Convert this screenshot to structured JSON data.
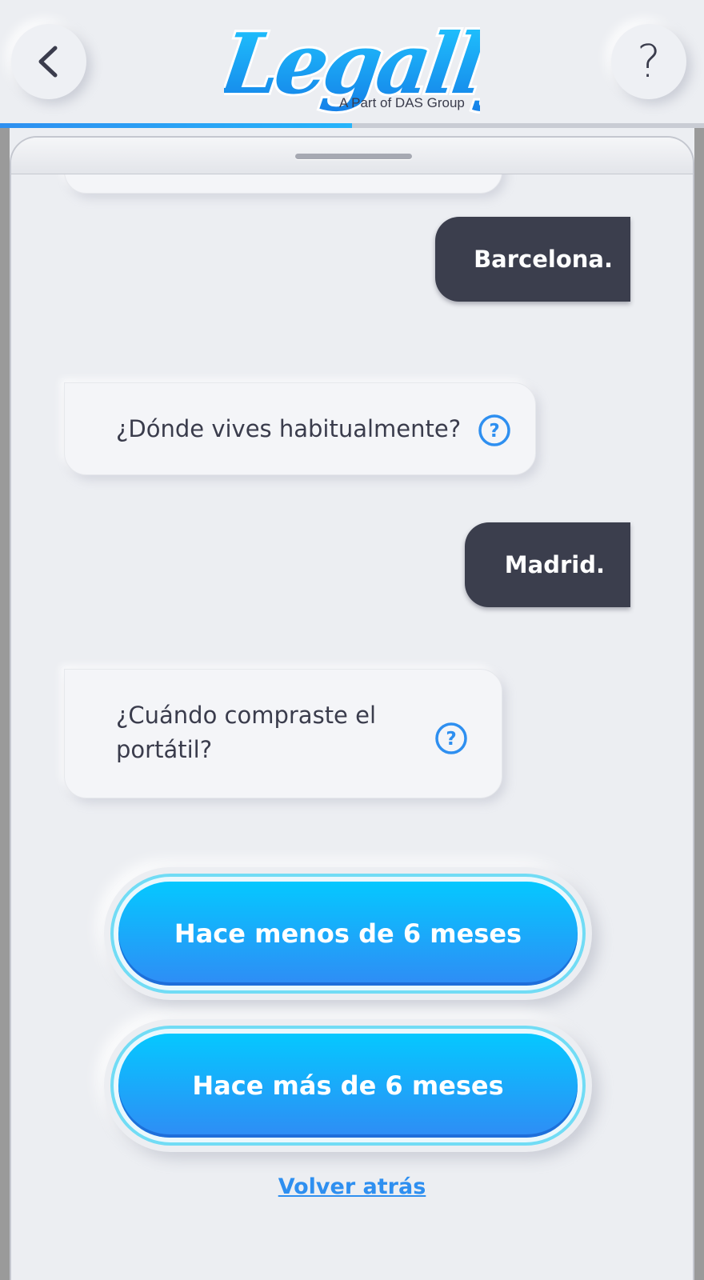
{
  "header": {
    "back_icon": "chevron-left-icon",
    "help_label": "?",
    "logo_text": "Legally",
    "logo_sub": "A Part of DAS Group",
    "progress": 0.5
  },
  "chat": {
    "messages": [
      {
        "from": "user",
        "text": "Barcelona."
      },
      {
        "from": "bot",
        "text": "¿Dónde vives habitualmente?",
        "help_icon": "question-circle-icon"
      },
      {
        "from": "user",
        "text": "Madrid."
      },
      {
        "from": "bot",
        "text": "¿Cuándo compraste el portátil?",
        "help_icon": "question-circle-icon"
      }
    ]
  },
  "answers": [
    {
      "label": "Hace menos de 6 meses"
    },
    {
      "label": "Hace más de 6 meses"
    }
  ],
  "back_link": "Volver atrás",
  "colors": {
    "accent": "#2e8ff0",
    "button_top": "#05c8ff",
    "button_bottom": "#2f8cf5",
    "user_bubble": "#3b3e4d",
    "background": "#eceef2"
  }
}
